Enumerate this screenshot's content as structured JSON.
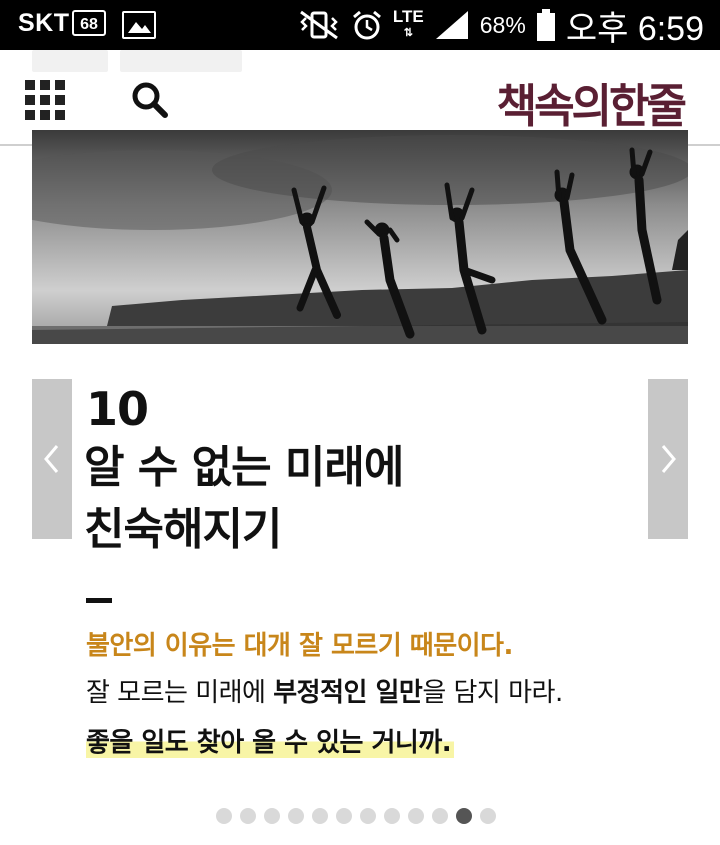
{
  "status_bar": {
    "carrier": "SKT",
    "notification_badge": "68",
    "network": "LTE",
    "battery": "68%",
    "time": "오후 6:59"
  },
  "header": {
    "menu_icon": "grid-menu-icon",
    "search_icon": "search-icon",
    "logo": "책속의한줄",
    "logo_color": "#5a1f33"
  },
  "card": {
    "number": "10",
    "title_line1": "알 수 없는 미래에",
    "title_line2": "친숙해지기",
    "quote_line1": "불안의 이유는 대개 잘 모르기 때문이다.",
    "quote_line2_a": "잘 모르는 미래에 ",
    "quote_line2_b": "부정적인 일만",
    "quote_line2_c": "을 담지 마라.",
    "quote_line3": "좋을 일도 찾아 올 수 있는 거니까.",
    "accent_color": "#c8861a",
    "highlight_color": "#f8f5a6"
  },
  "pager": {
    "total": 12,
    "active_index": 10
  }
}
